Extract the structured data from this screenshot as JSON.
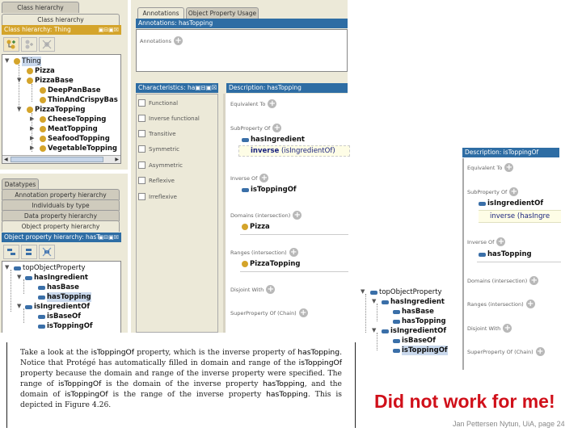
{
  "left_top": {
    "tabs": [
      "Class hierarchy (inferred)",
      "Class hierarchy"
    ],
    "panel_title": "Class hierarchy: Thing",
    "panel_buttons": "▣⊟▣☒",
    "toolbar": [
      "add-subclass-icon",
      "add-sibling-icon",
      "delete-class-icon"
    ],
    "tree": [
      {
        "label": "Thing",
        "depth": 0,
        "expanded": true,
        "selected": true
      },
      {
        "label": "Pizza",
        "depth": 1
      },
      {
        "label": "PizzaBase",
        "depth": 1,
        "expanded": true
      },
      {
        "label": "DeepPanBase",
        "depth": 2
      },
      {
        "label": "ThinAndCrispyBas",
        "depth": 2
      },
      {
        "label": "PizzaTopping",
        "depth": 1,
        "expanded": true
      },
      {
        "label": "CheeseTopping",
        "depth": 2,
        "collapsed": true
      },
      {
        "label": "MeatTopping",
        "depth": 2,
        "collapsed": true
      },
      {
        "label": "SeafoodTopping",
        "depth": 2,
        "collapsed": true
      },
      {
        "label": "VegetableTopping",
        "depth": 2,
        "collapsed": true
      }
    ]
  },
  "left_bottom": {
    "tabs": [
      "Datatypes",
      "Annotation property hierarchy",
      "Individuals by type",
      "Data property hierarchy",
      "Object property hierarchy"
    ],
    "panel_title": "Object property hierarchy: hasT",
    "panel_buttons": "▣⊟▣☒",
    "tree": [
      {
        "label": "topObjectProperty",
        "depth": 0
      },
      {
        "label": "hasIngredient",
        "depth": 1
      },
      {
        "label": "hasBase",
        "depth": 2
      },
      {
        "label": "hasTopping",
        "depth": 2,
        "selected": true
      },
      {
        "label": "isIngredientOf",
        "depth": 1
      },
      {
        "label": "isBaseOf",
        "depth": 2
      },
      {
        "label": "isToppingOf",
        "depth": 2
      }
    ]
  },
  "annotations": {
    "tabs": [
      "Annotations",
      "Object Property Usage"
    ],
    "header": "Annotations: hasTopping",
    "label": "Annotations"
  },
  "characteristics": {
    "header": "Characteristics: ha▣⊟▣☒",
    "items": [
      "Functional",
      "Inverse functional",
      "Transitive",
      "Symmetric",
      "Asymmetric",
      "Reflexive",
      "Irreflexive"
    ]
  },
  "description_left": {
    "header": "Description: hasTopping",
    "equivalent_to": "Equivalent To",
    "sub_property_of": "SubProperty Of",
    "sub_property_value": "hasIngredient",
    "inverse_kw": "inverse",
    "inverse_rest": "(isIngredientOf)",
    "inverse_of": "Inverse Of",
    "inverse_of_value": "isToppingOf",
    "domains": "Domains (intersection)",
    "domain_value": "Pizza",
    "ranges": "Ranges (intersection)",
    "range_value": "PizzaTopping",
    "disjoint": "Disjoint With",
    "chain": "SuperProperty Of (Chain)"
  },
  "right_tree": [
    {
      "label": "topObjectProperty",
      "depth": 0
    },
    {
      "label": "hasIngredient",
      "depth": 1
    },
    {
      "label": "hasBase",
      "depth": 2
    },
    {
      "label": "hasTopping",
      "depth": 2
    },
    {
      "label": "isIngredientOf",
      "depth": 1
    },
    {
      "label": "isBaseOf",
      "depth": 2
    },
    {
      "label": "isToppingOf",
      "depth": 2,
      "selected": true
    }
  ],
  "description_right": {
    "header": "Description: isToppingOf",
    "equivalent_to": "Equivalent To",
    "sub_property_of": "SubProperty Of",
    "sub_property_value": "isIngredientOf",
    "inverse_kw": "inverse",
    "inverse_rest": "(hasIngre",
    "inverse_of": "Inverse Of",
    "inverse_of_value": "hasTopping",
    "domains": "Domains (intersection)",
    "ranges": "Ranges (intersection)",
    "disjoint": "Disjoint With",
    "chain": "SuperProperty Of (Chain)"
  },
  "book": {
    "segments": [
      {
        "t": "Take a look at the ",
        "sf": false
      },
      {
        "t": "isToppingOf",
        "sf": true
      },
      {
        "t": " property, which is the inverse property of ",
        "sf": false
      },
      {
        "t": "hasTopping",
        "sf": true
      },
      {
        "t": ". Notice that Protégé has automatically filled in domain and range of the ",
        "sf": false
      },
      {
        "t": "isToppingOf",
        "sf": true
      },
      {
        "t": " property because the domain and range of the inverse property were specified. The range of ",
        "sf": false
      },
      {
        "t": "isToppingOf",
        "sf": true
      },
      {
        "t": " is the domain of the inverse property ",
        "sf": false
      },
      {
        "t": "hasTopping",
        "sf": true
      },
      {
        "t": ", and the domain of ",
        "sf": false
      },
      {
        "t": "isToppingOf",
        "sf": true
      },
      {
        "t": " is the range of the inverse property ",
        "sf": false
      },
      {
        "t": "hasTopping",
        "sf": true
      },
      {
        "t": ". This is depicted in Figure 4.26.",
        "sf": false
      }
    ]
  },
  "note": "Did not work for me!",
  "footer": "Jan Pettersen Nytun, UiA, page 24",
  "colors": {
    "panel_gold": "#d4a42b",
    "panel_blue": "#2e6da4",
    "note_red": "#d0101a",
    "class_dot": "#d4a42b",
    "property_bar": "#3a6fa8"
  }
}
